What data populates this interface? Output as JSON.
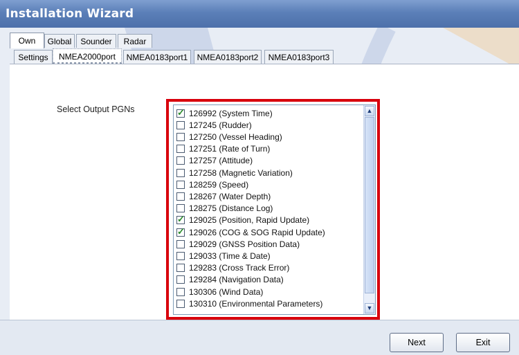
{
  "window": {
    "title": "Installation Wizard"
  },
  "tabs_top": [
    {
      "label": "Own",
      "active": true
    },
    {
      "label": "Global",
      "active": false
    },
    {
      "label": "Sounder",
      "active": false
    },
    {
      "label": "Radar",
      "active": false
    }
  ],
  "tabs_sub": [
    {
      "label": "Settings",
      "active": false
    },
    {
      "label": "NMEA2000port",
      "active": true
    },
    {
      "label": "NMEA0183port1",
      "active": false
    },
    {
      "label": "NMEA0183port2",
      "active": false
    },
    {
      "label": "NMEA0183port3",
      "active": false
    }
  ],
  "panel": {
    "pgn_label": "Select Output PGNs"
  },
  "pgns": [
    {
      "text": "126992 (System Time)",
      "checked": true
    },
    {
      "text": "127245 (Rudder)",
      "checked": false
    },
    {
      "text": "127250 (Vessel Heading)",
      "checked": false
    },
    {
      "text": "127251 (Rate of Turn)",
      "checked": false
    },
    {
      "text": "127257 (Attitude)",
      "checked": false
    },
    {
      "text": "127258 (Magnetic Variation)",
      "checked": false
    },
    {
      "text": "128259 (Speed)",
      "checked": false
    },
    {
      "text": "128267 (Water Depth)",
      "checked": false
    },
    {
      "text": "128275 (Distance Log)",
      "checked": false
    },
    {
      "text": "129025 (Position, Rapid Update)",
      "checked": true
    },
    {
      "text": "129026 (COG & SOG Rapid Update)",
      "checked": true
    },
    {
      "text": "129029 (GNSS Position Data)",
      "checked": false
    },
    {
      "text": "129033 (Time & Date)",
      "checked": false
    },
    {
      "text": "129283 (Cross Track Error)",
      "checked": false
    },
    {
      "text": "129284 (Navigation Data)",
      "checked": false
    },
    {
      "text": "130306 (Wind Data)",
      "checked": false
    },
    {
      "text": "130310 (Environmental Parameters)",
      "checked": false
    }
  ],
  "footer": {
    "next_label": "Next",
    "exit_label": "Exit"
  },
  "colors": {
    "highlight_border": "#d8000c",
    "title_bar": "#5b7fb8"
  }
}
